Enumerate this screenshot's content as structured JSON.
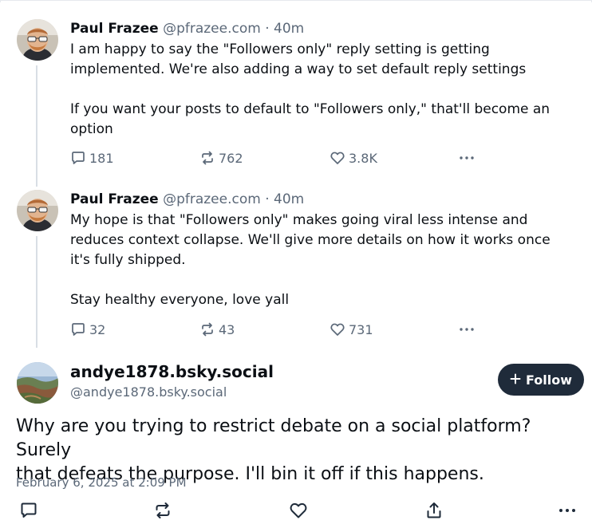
{
  "colors": {
    "text": "#0b0f14",
    "muted": "#5b6878",
    "thread_line": "#d9dee5",
    "follow_bg": "#1f2b3a",
    "follow_text": "#ffffff"
  },
  "thread": [
    {
      "author_name": "Paul Frazee",
      "author_handle": "@pfrazee.com",
      "separator": "·",
      "time": "40m",
      "lines": [
        "I am happy to say the \"Followers only\" reply setting is getting",
        "implemented. We're also adding a way to set default reply settings",
        "",
        "If you want your posts to default to \"Followers only,\" that'll become an",
        "option"
      ],
      "replies": "181",
      "reposts": "762",
      "likes": "3.8K"
    },
    {
      "author_name": "Paul Frazee",
      "author_handle": "@pfrazee.com",
      "separator": "·",
      "time": "40m",
      "lines": [
        "My hope is that \"Followers only\" makes going viral less intense and",
        "reduces context collapse. We'll give more details on how it works once",
        "it's fully shipped.",
        "",
        "Stay healthy everyone, love yall"
      ],
      "replies": "32",
      "reposts": "43",
      "likes": "731"
    }
  ],
  "main_post": {
    "author_name": "andye1878.bsky.social",
    "author_handle": "@andye1878.bsky.social",
    "follow_label": "Follow",
    "follow_icon": "plus-icon",
    "text_lines": [
      "Why are you trying to restrict debate on a social platform? Surely",
      "that defeats the purpose. I'll bin it off if this happens."
    ],
    "date": "February 6, 2025 at 2:09 PM",
    "action_icons": [
      "reply-icon",
      "repost-icon",
      "like-icon",
      "share-icon",
      "more-icon"
    ]
  }
}
